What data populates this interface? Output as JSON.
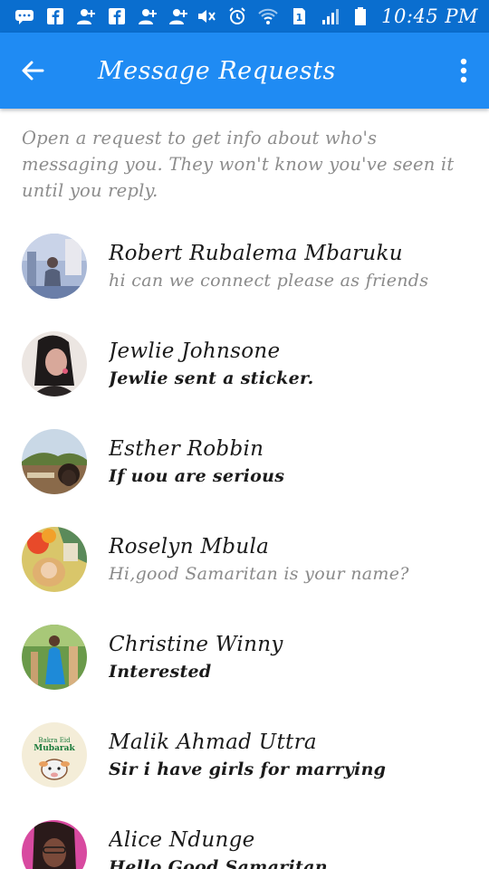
{
  "status_bar": {
    "time": "10:45 PM",
    "left_icons": [
      "chat-bubble-icon",
      "facebook-icon",
      "add-friend-icon",
      "facebook-icon",
      "add-friend-icon",
      "add-friend-icon"
    ],
    "right_icons": [
      "mute-icon",
      "alarm-icon",
      "wifi-icon",
      "sim-icon",
      "signal-icon",
      "battery-icon"
    ],
    "background": "#0a6ecf"
  },
  "app_bar": {
    "title": "Message Requests",
    "back_icon": "back-arrow-icon",
    "menu_icon": "more-vert-icon",
    "background": "#1f8bf3"
  },
  "description": "Open a request to get info about who's messaging you. They won't know you've seen it until you reply.",
  "requests": [
    {
      "name": "Robert Rubalema Mbaruku",
      "preview": "hi can we connect please as friends",
      "unread": false,
      "avatar_color": "#8aa0c8"
    },
    {
      "name": "Jewlie Johnsone",
      "preview": "Jewlie sent a sticker.",
      "unread": true,
      "avatar_color": "#d8b9a8"
    },
    {
      "name": "Esther Robbin",
      "preview": "If uou are serious",
      "unread": true,
      "avatar_color": "#9a7a5a"
    },
    {
      "name": "Roselyn Mbula",
      "preview": "Hi,good Samaritan is your name?",
      "unread": false,
      "avatar_color": "#e8a23a"
    },
    {
      "name": "Christine Winny",
      "preview": "Interested",
      "unread": true,
      "avatar_color": "#3a8a3a"
    },
    {
      "name": "Malik Ahmad Uttra",
      "preview": "Sir i have girls for marrying",
      "unread": true,
      "avatar_color": "#f2e9d0"
    },
    {
      "name": "Alice Ndunge",
      "preview": "Hello Good Samaritan",
      "unread": true,
      "avatar_color": "#c83a8a"
    }
  ],
  "colors": {
    "accent": "#1f8bf3",
    "name_text": "#1a1a1a",
    "read_preview": "#8a8a8a",
    "description_text": "#8d8d8d"
  }
}
